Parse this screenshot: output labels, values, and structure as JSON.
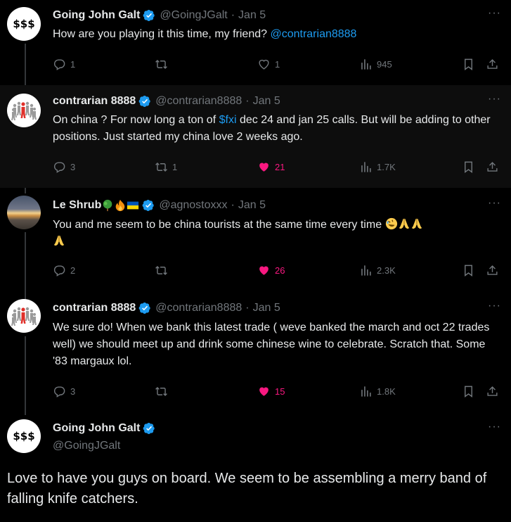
{
  "tweets": [
    {
      "name": "Going John Galt",
      "handle": "@GoingJGalt",
      "date": "Jan 5",
      "text_before": "How are you playing it this time, my friend? ",
      "mention": "@contrarian8888",
      "replies": "1",
      "reposts": "",
      "likes": "1",
      "views": "945",
      "avatar_text": "$$$"
    },
    {
      "name": "contrarian 8888",
      "handle": "@contrarian8888",
      "date": "Jan 5",
      "text_before": "On china ?  For now long a ton of ",
      "cashtag": "$fxi",
      "text_after": " dec 24 and jan 25 calls. But will be adding to other positions. Just started my china love 2 weeks ago.",
      "replies": "3",
      "reposts": "1",
      "likes": "21",
      "views": "1.7K"
    },
    {
      "name": "Le Shrub",
      "name_emojis": [
        "tree",
        "fire",
        "ukraine-flag"
      ],
      "handle": "@agnostoxxx",
      "date": "Jan 5",
      "text": "You and me seem to be china tourists at the same time every time ",
      "text_emojis": [
        "rofl",
        "folded-hands",
        "folded-hands",
        "folded-hands"
      ],
      "replies": "2",
      "reposts": "",
      "likes": "26",
      "views": "2.3K"
    },
    {
      "name": "contrarian 8888",
      "handle": "@contrarian8888",
      "date": "Jan 5",
      "text": "We sure do!  When we bank this latest trade ( weve banked the march and oct 22 trades well) we should meet up and drink some chinese wine to celebrate.  Scratch that. Some '83 margaux lol.",
      "replies": "3",
      "reposts": "",
      "likes": "15",
      "views": "1.8K"
    }
  ],
  "main_tweet": {
    "name": "Going John Galt",
    "handle": "@GoingJGalt",
    "text": "Love to have you guys on board. We seem to be assembling a merry band of falling knife catchers.",
    "avatar_text": "$$$"
  },
  "separators": {
    "dot": "·",
    "more": "···"
  },
  "colors": {
    "link": "#1d9bf0",
    "like": "#f91880",
    "muted": "#71767b",
    "verified": "#1d9bf0"
  }
}
